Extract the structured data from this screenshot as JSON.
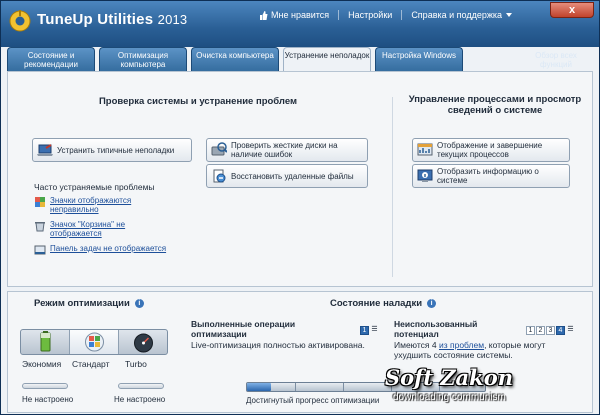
{
  "app": {
    "name": "TuneUp Utilities",
    "year": "2013"
  },
  "top_links": {
    "like": "Мне нравится",
    "settings": "Настройки",
    "help": "Справка и поддержка"
  },
  "close_label": "x",
  "tabs": [
    {
      "label": "Состояние и рекомендации"
    },
    {
      "label": "Оптимизация компьютера"
    },
    {
      "label": "Очистка компьютера"
    },
    {
      "label": "Устранение неполадок"
    },
    {
      "label": "Настройка Windows"
    }
  ],
  "all_functions": "Обзор всех функций",
  "main": {
    "left_title": "Проверка системы и устранение проблем",
    "right_title": "Управление процессами и просмотр сведений о системе",
    "btn_fix": "Устранить типичные неполадки",
    "btn_check_disks": "Проверить жесткие диски на наличие ошибок",
    "btn_restore_files": "Восстановить удаленные файлы",
    "btn_processes": "Отображение и завершение текущих процессов",
    "btn_sysinfo": "Отобразить информацию о системе",
    "frequent_title": "Часто устраняемые проблемы",
    "link_icons": "Значки отображаются неправильно",
    "link_recycle": "Значок \"Корзина\" не отображается",
    "link_taskbar": "Панель задач не отображается"
  },
  "bottom": {
    "mode_title": "Режим оптимизации",
    "state_title": "Состояние наладки",
    "modes": [
      "Экономия",
      "Стандарт",
      "Turbo"
    ],
    "not_configured_1": "Не настроено",
    "not_configured_2": "Не настроено",
    "done_title": "Выполненные операции оптимизации",
    "done_text": "Live-оптимизация полностью активирована.",
    "potential_title": "Неиспользованный потенциал",
    "potential_pre": "Имеются 4",
    "potential_link": "из проблем",
    "potential_post": ", которые могут ухудшить состояние системы.",
    "pager_left": [
      "1"
    ],
    "pager_right": [
      "1",
      "2",
      "3",
      "4"
    ],
    "progress_label": "Достигнутый прогресс оптимизации",
    "progress_fraction": 0.1
  },
  "watermark": {
    "main": "Soft Zakon",
    "sub": "downloading communism"
  },
  "colors": {
    "titlebar": "#2a5f95",
    "tab": "#356d9f",
    "link": "#1d4f9a",
    "accent": "#2e69ad"
  },
  "icons": [
    "tuneup-logo-icon",
    "thumbs-up-icon",
    "chevron-down-icon",
    "close-icon",
    "laptop-fix-icon",
    "disk-check-icon",
    "restore-files-icon",
    "processes-icon",
    "system-info-icon",
    "desktop-icons-icon",
    "recycle-bin-icon",
    "taskbar-icon",
    "battery-icon",
    "standard-mode-icon",
    "speedometer-icon",
    "info-icon",
    "menu-icon"
  ]
}
